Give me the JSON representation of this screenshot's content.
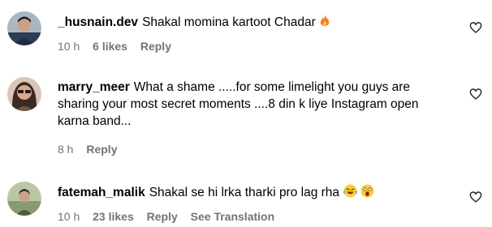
{
  "comments": [
    {
      "username": "_husnain.dev",
      "text": "Shakal momina kartoot Chadar",
      "time": "10 h",
      "likes": "6 likes",
      "reply": "Reply",
      "emoji": [
        "fire-emoji"
      ]
    },
    {
      "username": "marry_meer",
      "text": "What a shame .....for some limelight you guys are sharing your most secret moments ....8 din k liye Instagram open karna band...",
      "time": "8 h",
      "reply": "Reply"
    },
    {
      "username": "fatemah_malik",
      "text": "Shakal se hi lrka tharki pro lag rha",
      "time": "10 h",
      "likes": "23 likes",
      "reply": "Reply",
      "see_translation": "See Translation",
      "emoji": [
        "laughing-emoji",
        "shocked-emoji"
      ]
    }
  ],
  "colors": {
    "meta_gray": "#737373",
    "text": "#000000",
    "background": "#ffffff"
  }
}
